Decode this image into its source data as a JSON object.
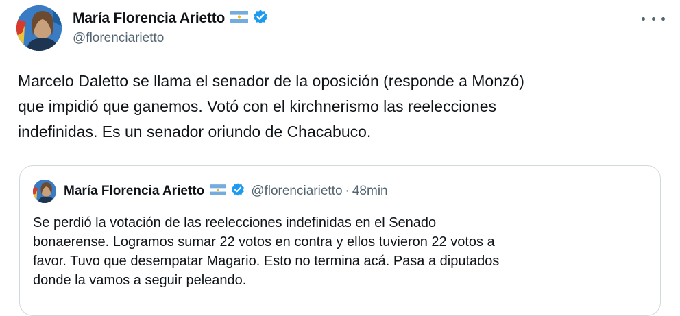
{
  "author": {
    "name": "María Florencia Arietto",
    "handle": "@florenciarietto",
    "flag_icon": "argentina-flag-icon",
    "verified_icon": "verified-badge-icon",
    "verified_color": "#1d9bf0"
  },
  "tweet": {
    "text": "Marcelo Daletto se llama el senador de la oposición (responde a Monzó)\nque impidió que ganemos. Votó con el kirchnerismo las reelecciones\nindefinidas. Es un senador oriundo de Chacabuco."
  },
  "more_icon": "more-options-icon",
  "quoted": {
    "name": "María Florencia Arietto",
    "handle": "@florenciarietto",
    "separator": "·",
    "time": "48min",
    "text": "Se perdió la votación de las reelecciones indefinidas en el Senado\nbonaerense. Logramos sumar 22 votos en contra y ellos tuvieron 22 votos a\nfavor. Tuvo que desempatar Magario. Esto no termina acá. Pasa a diputados\ndonde la vamos a seguir peleando."
  }
}
